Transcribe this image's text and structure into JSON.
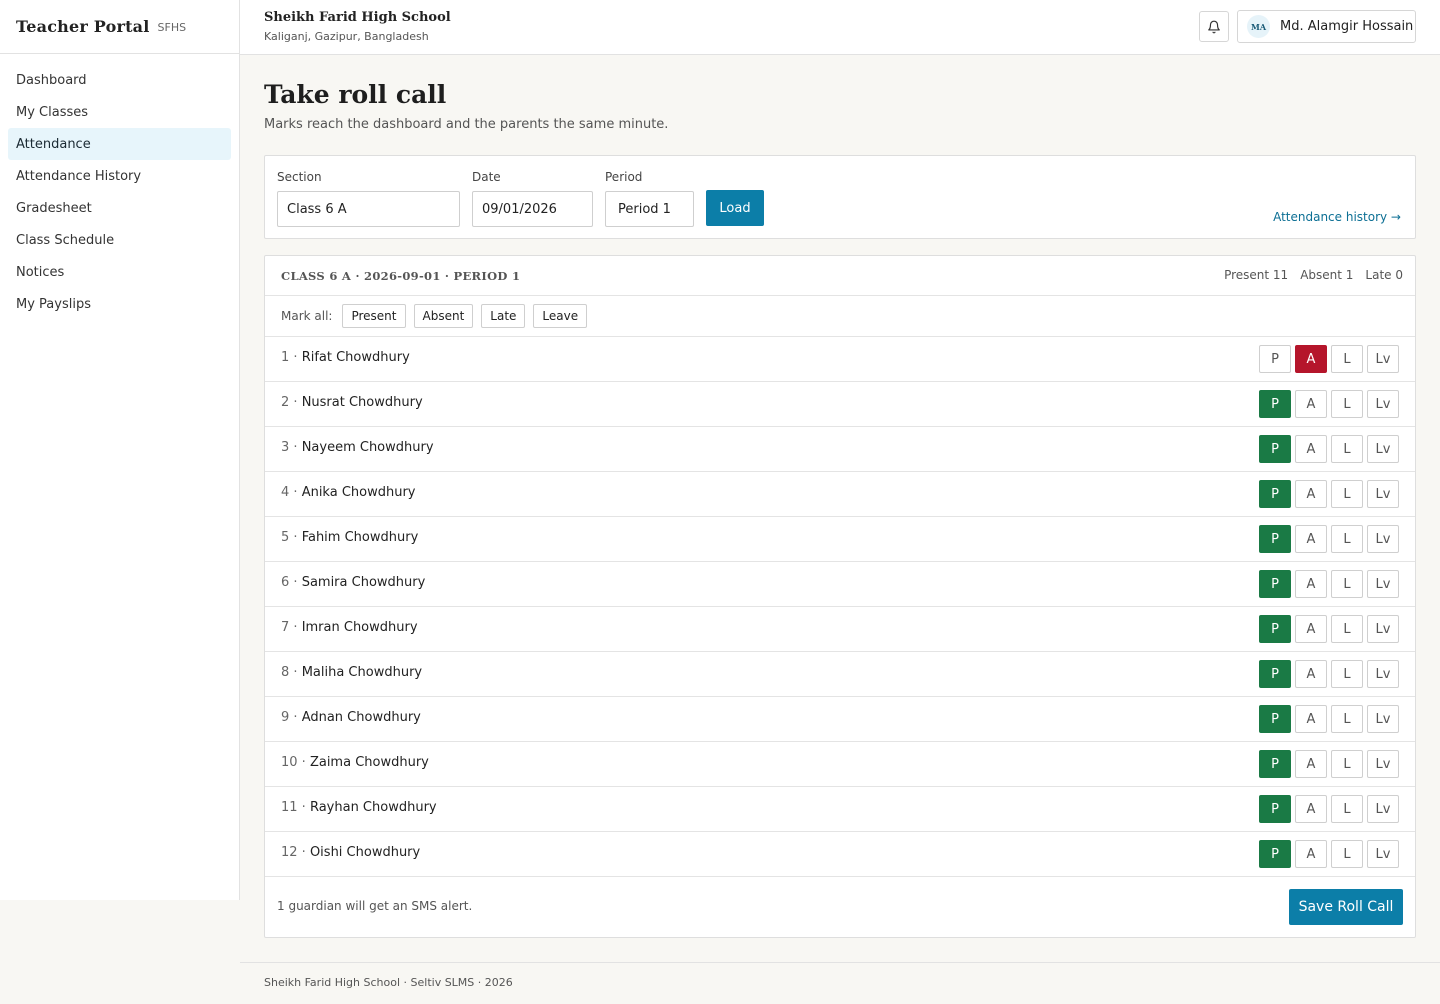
{
  "brand": {
    "title": "Teacher Portal",
    "code": "SFHS"
  },
  "sidebar": {
    "items": [
      {
        "label": "Dashboard",
        "active": false
      },
      {
        "label": "My Classes",
        "active": false
      },
      {
        "label": "Attendance",
        "active": true
      },
      {
        "label": "Attendance History",
        "active": false
      },
      {
        "label": "Gradesheet",
        "active": false
      },
      {
        "label": "Class Schedule",
        "active": false
      },
      {
        "label": "Notices",
        "active": false
      },
      {
        "label": "My Payslips",
        "active": false
      }
    ]
  },
  "header": {
    "school_name": "Sheikh Farid High School",
    "school_location": "Kaliganj, Gazipur, Bangladesh",
    "user_initials": "MA",
    "user_name": "Md. Alamgir Hossain",
    "bell_icon": "bell-icon"
  },
  "page": {
    "title": "Take roll call",
    "subtitle": "Marks reach the dashboard and the parents the same minute."
  },
  "filters": {
    "section_label": "Section",
    "section_value": "Class 6 A",
    "date_label": "Date",
    "date_value": "09/01/2026",
    "period_label": "Period",
    "period_value": "Period 1",
    "load_label": "Load",
    "history_link": "Attendance history →"
  },
  "roll": {
    "title": "CLASS 6 A · 2026-09-01 · PERIOD 1",
    "present_label": "Present 11",
    "absent_label": "Absent 1",
    "late_label": "Late 0",
    "markall_label": "Mark all:",
    "markall_buttons": [
      "Present",
      "Absent",
      "Late",
      "Leave"
    ],
    "option_labels": [
      "P",
      "A",
      "L",
      "Lv"
    ],
    "students": [
      {
        "num": "1 ·",
        "name": "Rifat Chowdhury",
        "status": "A"
      },
      {
        "num": "2 ·",
        "name": "Nusrat Chowdhury",
        "status": "P"
      },
      {
        "num": "3 ·",
        "name": "Nayeem Chowdhury",
        "status": "P"
      },
      {
        "num": "4 ·",
        "name": "Anika Chowdhury",
        "status": "P"
      },
      {
        "num": "5 ·",
        "name": "Fahim Chowdhury",
        "status": "P"
      },
      {
        "num": "6 ·",
        "name": "Samira Chowdhury",
        "status": "P"
      },
      {
        "num": "7 ·",
        "name": "Imran Chowdhury",
        "status": "P"
      },
      {
        "num": "8 ·",
        "name": "Maliha Chowdhury",
        "status": "P"
      },
      {
        "num": "9 ·",
        "name": "Adnan Chowdhury",
        "status": "P"
      },
      {
        "num": "10 ·",
        "name": "Zaima Chowdhury",
        "status": "P"
      },
      {
        "num": "11 ·",
        "name": "Rayhan Chowdhury",
        "status": "P"
      },
      {
        "num": "12 ·",
        "name": "Oishi Chowdhury",
        "status": "P"
      }
    ],
    "sms_note": "1 guardian will get an SMS alert.",
    "save_label": "Save Roll Call"
  },
  "colors": {
    "accent": "#0c7ea8",
    "present": "#1a7a45",
    "absent": "#b5152b",
    "active_nav_bg": "#e7f5fb"
  },
  "footer": {
    "text": "Sheikh Farid High School · Seltiv SLMS · 2026"
  }
}
